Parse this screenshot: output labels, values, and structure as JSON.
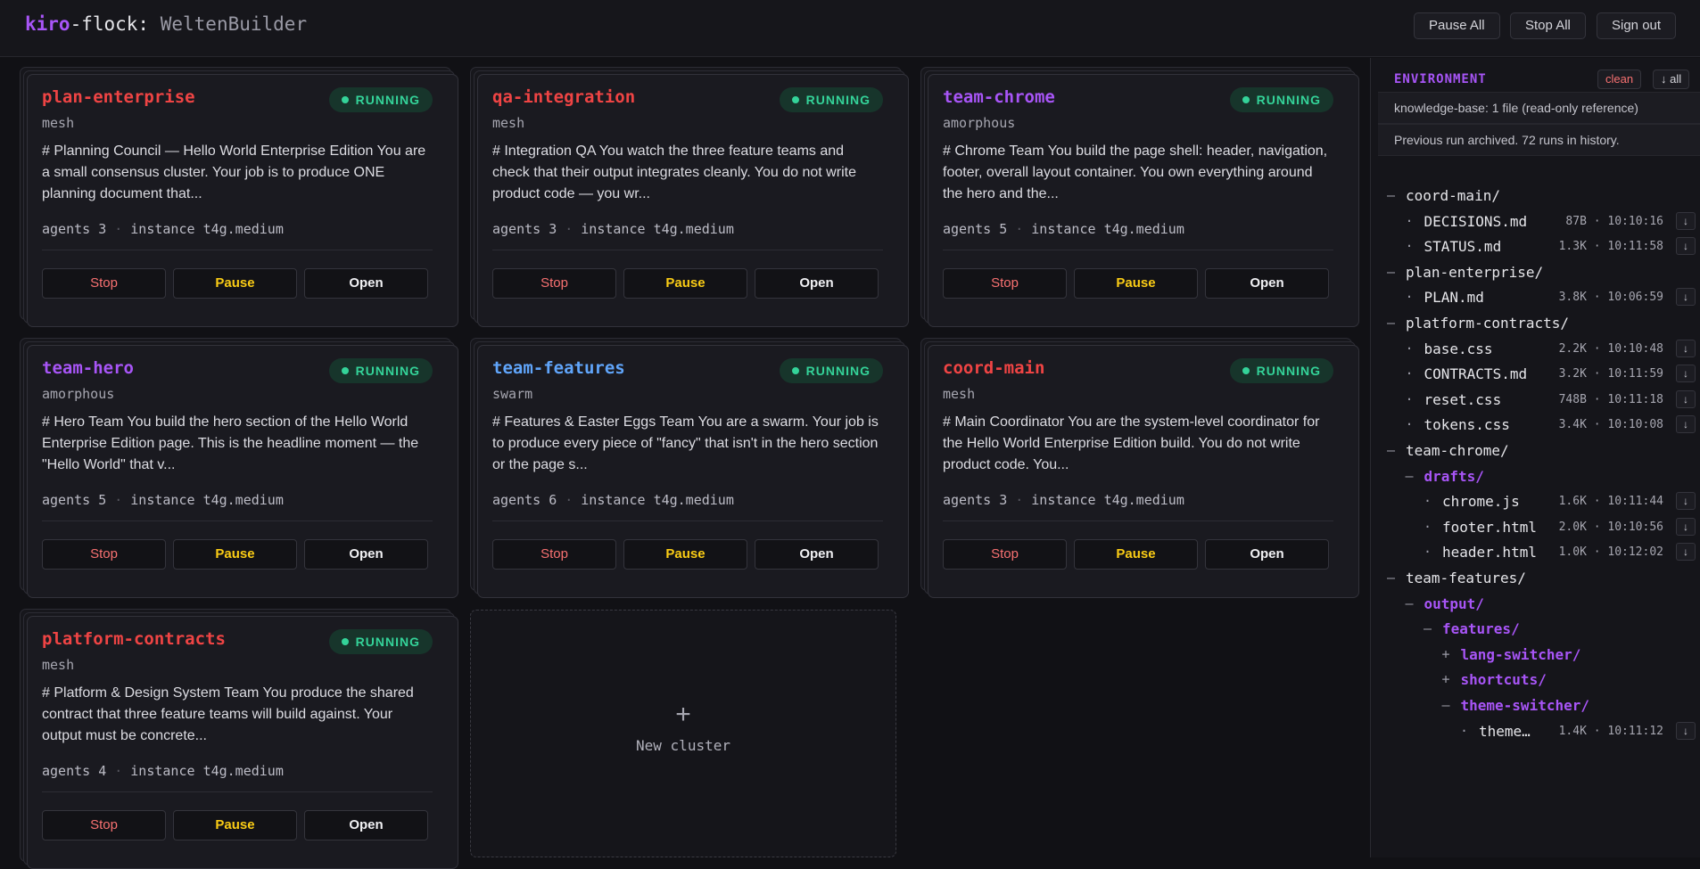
{
  "app": {
    "brand_prefix": "kiro",
    "brand_mid": "-flock: ",
    "brand_name": "WeltenBuilder"
  },
  "header": {
    "pause_all": "Pause All",
    "stop_all": "Stop All",
    "sign_out": "Sign out"
  },
  "card_buttons": {
    "stop": "Stop",
    "pause": "Pause",
    "open": "Open"
  },
  "meta_labels": {
    "agents": "agents",
    "instance": "instance"
  },
  "clusters": [
    {
      "name": "plan-enterprise",
      "color": "#ef4444",
      "type": "mesh",
      "status": "RUNNING",
      "description": "# Planning Council — Hello World Enterprise Edition You are a small consensus cluster. Your job is to produce ONE planning document that...",
      "agents": "3",
      "instance": "t4g.medium"
    },
    {
      "name": "qa-integration",
      "color": "#ef4444",
      "type": "mesh",
      "status": "RUNNING",
      "description": "# Integration QA You watch the three feature teams and check that their output integrates cleanly. You do not write product code — you wr...",
      "agents": "3",
      "instance": "t4g.medium"
    },
    {
      "name": "team-chrome",
      "color": "#a855f7",
      "type": "amorphous",
      "status": "RUNNING",
      "description": "# Chrome Team You build the page shell: header, navigation, footer, overall layout container. You own everything around the hero and the...",
      "agents": "5",
      "instance": "t4g.medium"
    },
    {
      "name": "team-hero",
      "color": "#a855f7",
      "type": "amorphous",
      "status": "RUNNING",
      "description": "# Hero Team You build the hero section of the Hello World Enterprise Edition page. This is the headline moment — the \"Hello World\" that v...",
      "agents": "5",
      "instance": "t4g.medium"
    },
    {
      "name": "team-features",
      "color": "#60a5fa",
      "type": "swarm",
      "status": "RUNNING",
      "description": "# Features & Easter Eggs Team You are a swarm. Your job is to produce every piece of \"fancy\" that isn't in the hero section or the page s...",
      "agents": "6",
      "instance": "t4g.medium"
    },
    {
      "name": "coord-main",
      "color": "#ef4444",
      "type": "mesh",
      "status": "RUNNING",
      "description": "# Main Coordinator You are the system-level coordinator for the Hello World Enterprise Edition build. You do not write product code. You...",
      "agents": "3",
      "instance": "t4g.medium"
    },
    {
      "name": "platform-contracts",
      "color": "#ef4444",
      "type": "mesh",
      "status": "RUNNING",
      "description": "# Platform & Design System Team You produce the shared contract that three feature teams will build against. Your output must be concrete...",
      "agents": "4",
      "instance": "t4g.medium"
    }
  ],
  "new_cluster": {
    "icon": "+",
    "label": "New cluster"
  },
  "environment": {
    "title": "ENVIRONMENT",
    "clean_label": "clean",
    "clean_color": "#f87171",
    "all_label": "↓ all",
    "kb_info": "knowledge-base: 1 file (read-only reference)",
    "archive_info": "Previous run archived. 72 runs in history.",
    "tree": [
      {
        "toggle": "–",
        "name": "coord-main/",
        "kind": "dir",
        "depth": 0
      },
      {
        "toggle": "·",
        "name": "DECISIONS.md",
        "kind": "file",
        "depth": 1,
        "meta": "87B · 10:10:16"
      },
      {
        "toggle": "·",
        "name": "STATUS.md",
        "kind": "file",
        "depth": 1,
        "meta": "1.3K · 10:11:58"
      },
      {
        "toggle": "–",
        "name": "plan-enterprise/",
        "kind": "dir",
        "depth": 0
      },
      {
        "toggle": "·",
        "name": "PLAN.md",
        "kind": "file",
        "depth": 1,
        "meta": "3.8K · 10:06:59"
      },
      {
        "toggle": "–",
        "name": "platform-contracts/",
        "kind": "dir",
        "depth": 0
      },
      {
        "toggle": "·",
        "name": "base.css",
        "kind": "file",
        "depth": 1,
        "meta": "2.2K · 10:10:48"
      },
      {
        "toggle": "·",
        "name": "CONTRACTS.md",
        "kind": "file",
        "depth": 1,
        "meta": "3.2K · 10:11:59"
      },
      {
        "toggle": "·",
        "name": "reset.css",
        "kind": "file",
        "depth": 1,
        "meta": "748B · 10:11:18"
      },
      {
        "toggle": "·",
        "name": "tokens.css",
        "kind": "file",
        "depth": 1,
        "meta": "3.4K · 10:10:08"
      },
      {
        "toggle": "–",
        "name": "team-chrome/",
        "kind": "dir",
        "depth": 0
      },
      {
        "toggle": "–",
        "name": "drafts/",
        "kind": "dir-p",
        "depth": 1
      },
      {
        "toggle": "·",
        "name": "chrome.js",
        "kind": "file",
        "depth": 2,
        "meta": "1.6K · 10:11:44"
      },
      {
        "toggle": "·",
        "name": "footer.html",
        "kind": "file",
        "depth": 2,
        "meta": "2.0K · 10:10:56"
      },
      {
        "toggle": "·",
        "name": "header.html",
        "kind": "file",
        "depth": 2,
        "meta": "1.0K · 10:12:02"
      },
      {
        "toggle": "–",
        "name": "team-features/",
        "kind": "dir",
        "depth": 0
      },
      {
        "toggle": "–",
        "name": "output/",
        "kind": "dir-p",
        "depth": 1
      },
      {
        "toggle": "–",
        "name": "features/",
        "kind": "dir-p",
        "depth": 2
      },
      {
        "toggle": "+",
        "name": "lang-switcher/",
        "kind": "dir-p",
        "depth": 3
      },
      {
        "toggle": "+",
        "name": "shortcuts/",
        "kind": "dir-p",
        "depth": 3
      },
      {
        "toggle": "–",
        "name": "theme-switcher/",
        "kind": "dir-p",
        "depth": 3
      },
      {
        "toggle": "·",
        "name": "theme…",
        "kind": "file",
        "depth": 4,
        "meta": "1.4K · 10:11:12"
      }
    ]
  },
  "download_icon": "↓"
}
